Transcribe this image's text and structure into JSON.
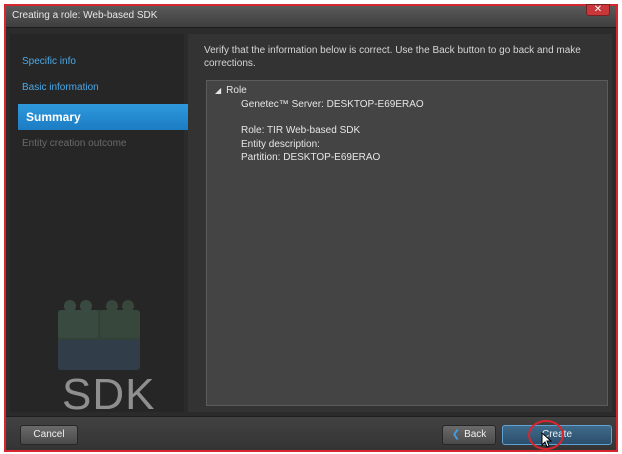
{
  "window": {
    "title": "Creating a role: Web-based SDK",
    "close_glyph": "✕"
  },
  "sidebar": {
    "items": [
      {
        "label": "Specific info",
        "state": "link"
      },
      {
        "label": "Basic information",
        "state": "link"
      },
      {
        "label": "Summary",
        "state": "selected"
      },
      {
        "label": "Entity creation outcome",
        "state": "disabled"
      }
    ],
    "logo_text": "SDK"
  },
  "main": {
    "instruction": "Verify that the information below is correct. Use the Back button to go back and make corrections.",
    "summary": {
      "root_label": "Role",
      "server_line": "Genetec™ Server: DESKTOP-E69ERAO",
      "role_line": "Role: TIR Web-based SDK",
      "description_line": "Entity description:",
      "partition_line": "Partition: DESKTOP-E69ERAO"
    }
  },
  "footer": {
    "cancel_label": "Cancel",
    "back_label": "Back",
    "create_label": "Create"
  },
  "colors": {
    "accent": "#2f99dc",
    "link": "#4aa8e8",
    "highlight_border": "#d8262e"
  },
  "icons": {
    "close": "close-icon",
    "expand": "triangle-expanded-icon",
    "back": "chevron-left-icon",
    "cursor": "mouse-pointer-icon",
    "logo": "sdk-blocks-icon"
  }
}
